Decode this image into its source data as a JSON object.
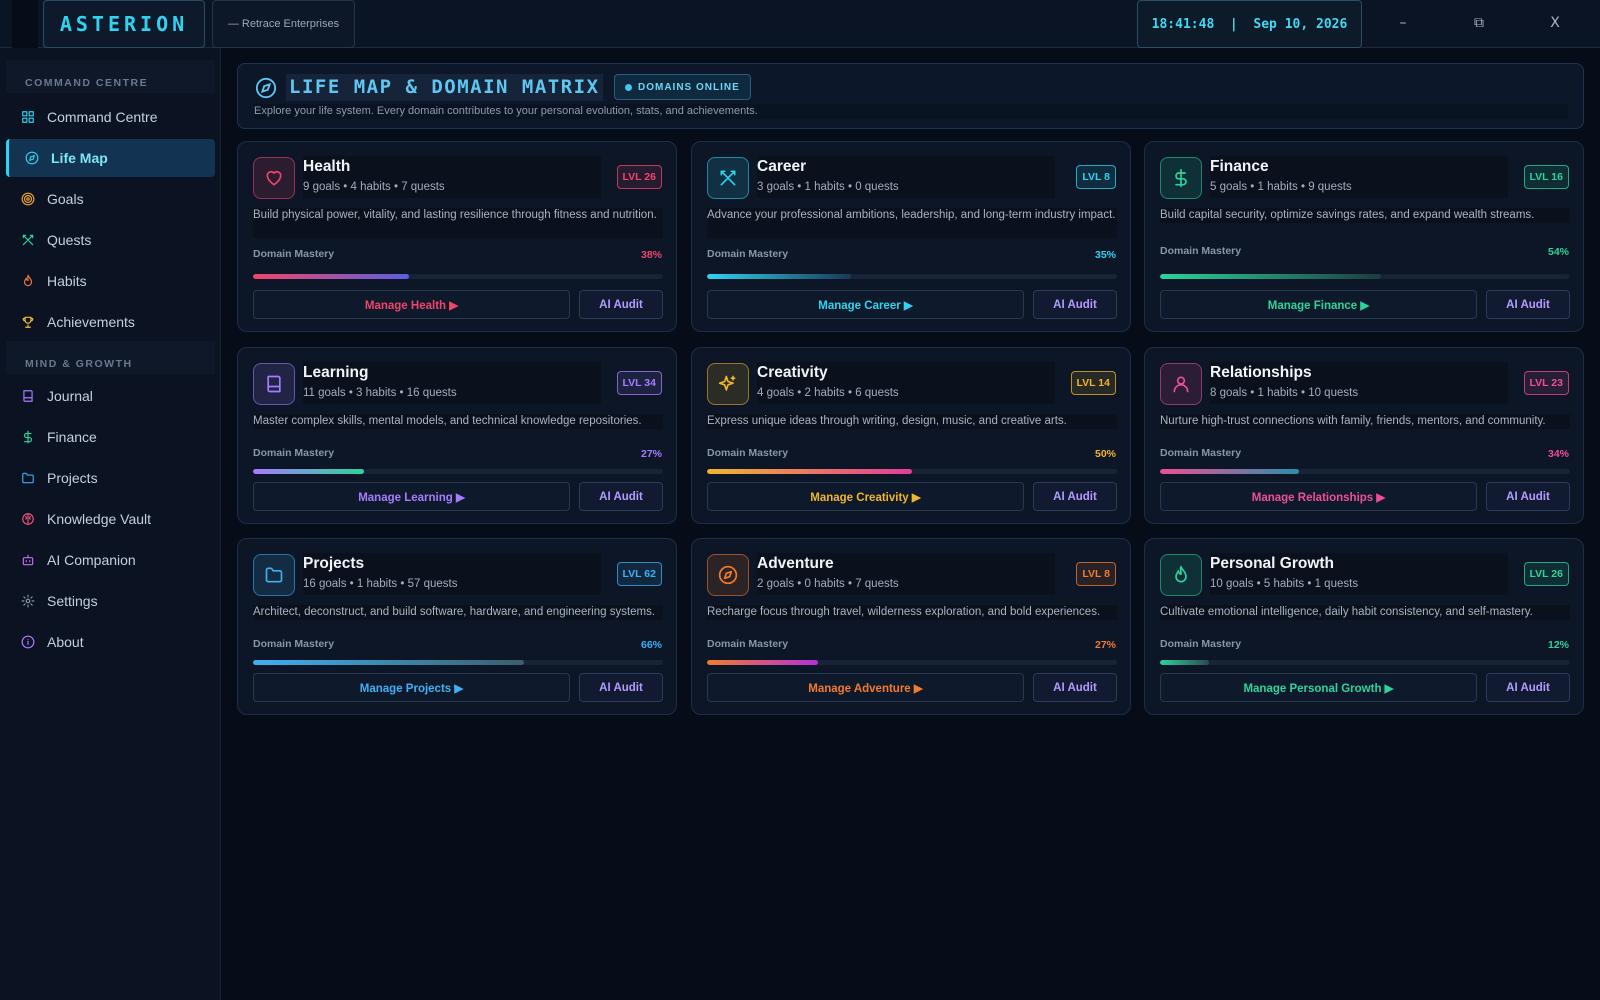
{
  "app": {
    "brand": "ASTERION",
    "org": "— Retrace Enterprises",
    "clock": "18:41:48  |  Sep 10, 2026",
    "win": {
      "minimize": "–",
      "restore": "⧉",
      "close": "X"
    }
  },
  "sidebar": {
    "sections": [
      {
        "title": "COMMAND CENTRE",
        "items": [
          {
            "label": "Command Centre",
            "icon": "grid-icon",
            "color": "#2fd3ef"
          },
          {
            "label": "Life Map",
            "icon": "compass-icon",
            "color": "#2fd3ef",
            "active": true
          },
          {
            "label": "Goals",
            "icon": "target-icon",
            "color": "#f0a52a"
          },
          {
            "label": "Quests",
            "icon": "swords-icon",
            "color": "#2bd49a"
          },
          {
            "label": "Habits",
            "icon": "flame-icon",
            "color": "#f27b2e"
          },
          {
            "label": "Achievements",
            "icon": "trophy-icon",
            "color": "#f0c12a"
          }
        ]
      },
      {
        "title": "MIND & GROWTH",
        "items": [
          {
            "label": "Journal",
            "icon": "book-icon",
            "color": "#a57cff"
          },
          {
            "label": "Finance",
            "icon": "dollar-icon",
            "color": "#2bd49a"
          },
          {
            "label": "Projects",
            "icon": "folder-icon",
            "color": "#3fa8f2"
          },
          {
            "label": "Knowledge Vault",
            "icon": "brain-icon",
            "color": "#f2517b"
          },
          {
            "label": "AI Companion",
            "icon": "bot-icon",
            "color": "#c76bf2"
          },
          {
            "label": "Settings",
            "icon": "gear-icon",
            "color": "#8795a8"
          },
          {
            "label": "About",
            "icon": "info-icon",
            "color": "#b07cff"
          }
        ]
      }
    ]
  },
  "header": {
    "title": "LIFE MAP & DOMAIN MATRIX",
    "badge": "DOMAINS ONLINE",
    "description": "Explore your life system. Every domain contributes to your personal evolution, stats, and achievements."
  },
  "mastery_label": "Domain Mastery",
  "audit_label": "AI Audit",
  "domains": [
    {
      "name": "Health",
      "stats": "9 goals • 4 habits • 7 quests",
      "level": "LVL 26",
      "description": "Build physical power, vitality, and lasting resilience through fitness and nutrition.",
      "mastery": "38%",
      "manage": "Manage Health ▶",
      "icon": "heart-icon",
      "color": "#f2456a",
      "gradient": [
        "#f2456a",
        "#5a5fe0"
      ]
    },
    {
      "name": "Career",
      "stats": "3 goals • 1 habits • 0 quests",
      "level": "LVL 8",
      "description": "Advance your professional ambitions, leadership, and long-term industry impact.",
      "mastery": "35%",
      "manage": "Manage Career ▶",
      "icon": "swords-icon",
      "color": "#2fd3ef",
      "gradient": [
        "#2fd3ef",
        "#1a3a55"
      ]
    },
    {
      "name": "Finance",
      "stats": "5 goals • 1 habits • 9 quests",
      "level": "LVL 16",
      "description": "Build capital security, optimize savings rates, and expand wealth streams.",
      "mastery": "54%",
      "manage": "Manage Finance ▶",
      "icon": "dollar-icon",
      "color": "#2bd49a",
      "gradient": [
        "#2bd49a",
        "#1d3c40"
      ]
    },
    {
      "name": "Learning",
      "stats": "11 goals • 3 habits • 16 quests",
      "level": "LVL 34",
      "description": "Master complex skills, mental models, and technical knowledge repositories.",
      "mastery": "27%",
      "manage": "Manage Learning ▶",
      "icon": "book-icon",
      "color": "#a57cff",
      "gradient": [
        "#a57cff",
        "#2bd49a"
      ]
    },
    {
      "name": "Creativity",
      "stats": "4 goals • 2 habits • 6 quests",
      "level": "LVL 14",
      "description": "Express unique ideas through writing, design, music, and creative arts.",
      "mastery": "50%",
      "manage": "Manage Creativity ▶",
      "icon": "sparkle-icon",
      "color": "#f0b52a",
      "gradient": [
        "#f0b52a",
        "#e23c9c"
      ]
    },
    {
      "name": "Relationships",
      "stats": "8 goals • 1 habits • 10 quests",
      "level": "LVL 23",
      "description": "Nurture high-trust connections with family, friends, mentors, and community.",
      "mastery": "34%",
      "manage": "Manage Relationships ▶",
      "icon": "user-icon",
      "color": "#ee4f96",
      "gradient": [
        "#ee4f96",
        "#2a8fa8"
      ]
    },
    {
      "name": "Projects",
      "stats": "16 goals • 1 habits • 57 quests",
      "level": "LVL 62",
      "description": "Architect, deconstruct, and build software, hardware, and engineering systems.",
      "mastery": "66%",
      "manage": "Manage Projects ▶",
      "icon": "folder-icon",
      "color": "#3fb0f2",
      "gradient": [
        "#3fb0f2",
        "#3a5f6a"
      ]
    },
    {
      "name": "Adventure",
      "stats": "2 goals • 0 habits • 7 quests",
      "level": "LVL 8",
      "description": "Recharge focus through travel, wilderness exploration, and bold experiences.",
      "mastery": "27%",
      "manage": "Manage Adventure ▶",
      "icon": "compass-icon",
      "color": "#f27b2e",
      "gradient": [
        "#f27b2e",
        "#b52fd9"
      ]
    },
    {
      "name": "Personal Growth",
      "stats": "10 goals • 5 habits • 1 quests",
      "level": "LVL 26",
      "description": "Cultivate emotional intelligence, daily habit consistency, and self-mastery.",
      "mastery": "12%",
      "manage": "Manage Personal Growth ▶",
      "icon": "flame-icon",
      "color": "#2bd49a",
      "gradient": [
        "#2bd49a",
        "#2a4a55"
      ]
    }
  ]
}
